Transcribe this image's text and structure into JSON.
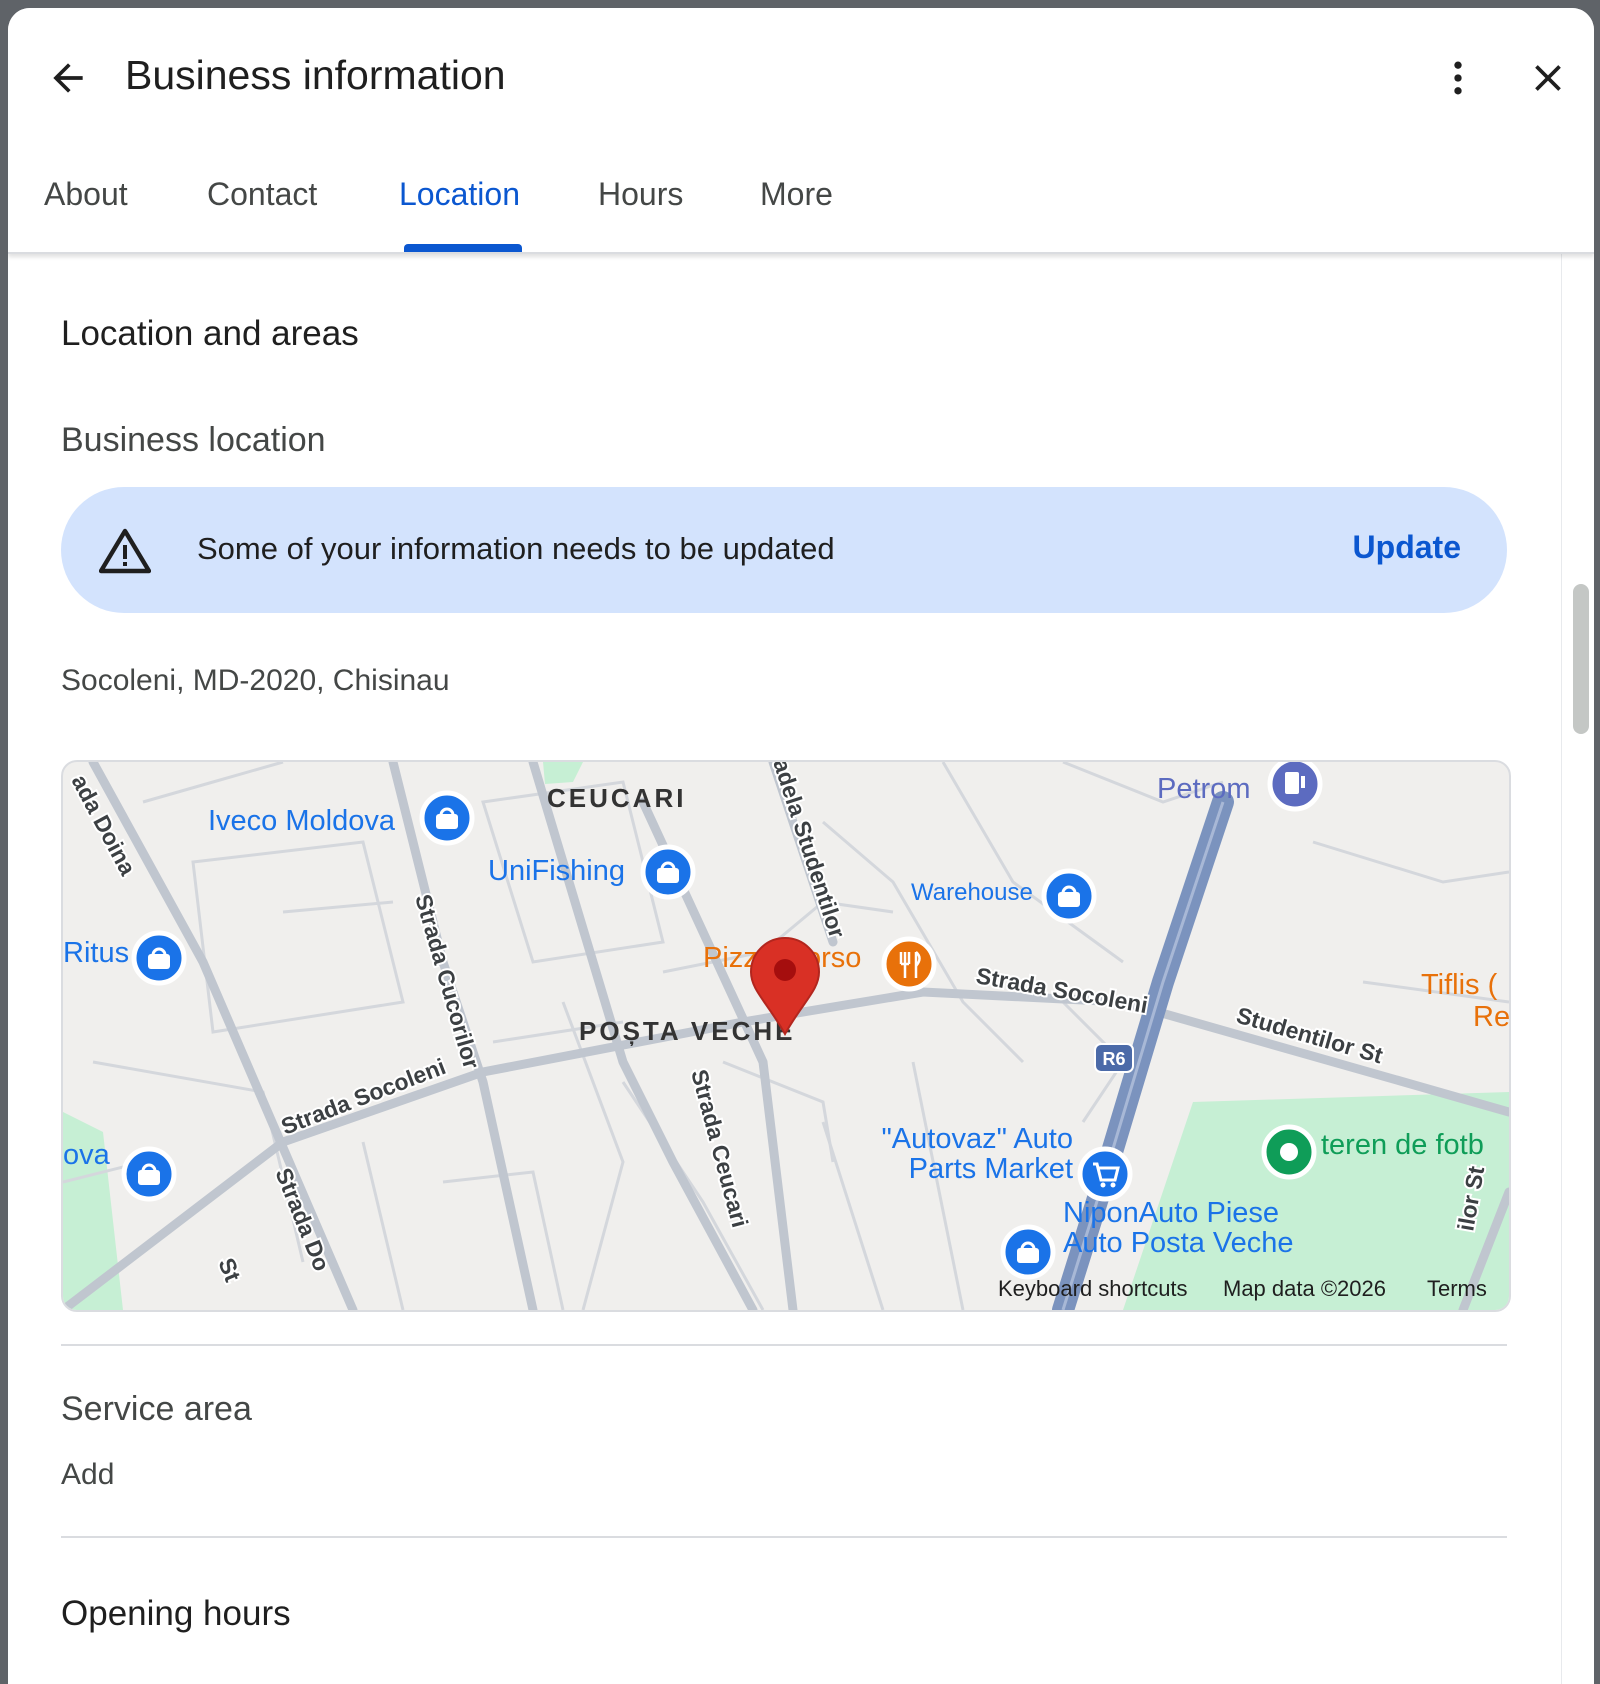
{
  "header": {
    "title": "Business information",
    "back_icon": "arrow-left-icon",
    "more_icon": "more-vert-icon",
    "close_icon": "close-icon"
  },
  "tabs": [
    {
      "label": "About",
      "active": false
    },
    {
      "label": "Contact",
      "active": false
    },
    {
      "label": "Location",
      "active": true
    },
    {
      "label": "Hours",
      "active": false
    },
    {
      "label": "More",
      "active": false
    }
  ],
  "content": {
    "section_title": "Location and areas",
    "business_location": {
      "label": "Business location",
      "banner": {
        "icon": "warning-icon",
        "message": "Some of your information needs to be updated",
        "action": "Update"
      },
      "address": "Socoleni, MD-2020, Chisinau"
    },
    "map": {
      "neighborhoods": [
        "CEUCARI",
        "POȘTA VECHE"
      ],
      "streets": [
        "ada Doina",
        "Strada Cucorilor",
        "Strada Socoleni",
        "Strada Socoleni",
        "Strada Ceucari",
        "adela Studentilor",
        "Studentilor St",
        "Strada Do",
        "St",
        "ilor St"
      ],
      "places": [
        "Iveco Moldova",
        "UniFishing",
        "Ritus",
        "ova",
        "Warehouse",
        "Petrom",
        "Pizz",
        "orso",
        "\"Autovaz\" Auto",
        "Parts Market",
        "NiponAuto Piese",
        "Auto Posta Veche",
        "teren de fotb",
        "Tiflis (",
        "Re"
      ],
      "road_badge": "R6",
      "footer": [
        "Keyboard shortcuts",
        "Map data ©2026",
        "Terms"
      ],
      "colors": {
        "shop_pin": "#1a73e8",
        "food_pin": "#e8710a",
        "fuel_pin": "#5c6bc0",
        "park_pin": "#0f9d58",
        "location_pin": "#d93025",
        "highway": "#7b93be",
        "park": "#c6efd4"
      }
    },
    "service_area": {
      "label": "Service area",
      "action": "Add"
    },
    "opening_hours": {
      "label": "Opening hours"
    }
  }
}
